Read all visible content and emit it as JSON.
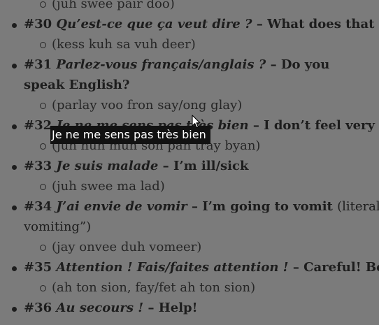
{
  "entries": [
    {
      "num": "",
      "french": "",
      "dash": "",
      "english": "",
      "literal": "",
      "pron": "(juh swee pair doo)"
    },
    {
      "num": "#30",
      "french": "Qu’est-ce que ça veut dire ?",
      "dash": "–",
      "english": "What does that m",
      "literal": "",
      "pron": "(kess kuh sa vuh deer)"
    },
    {
      "num": "#31",
      "french": "Parlez-vous français/anglais ?",
      "dash": "–",
      "english": "Do you speak English?",
      "literal": "",
      "pron": "(parlay voo fron say/ong glay)"
    },
    {
      "num": "#32",
      "french": "Je ne me sens pas très bien",
      "dash": "–",
      "english": "I don’t feel very w",
      "literal": "",
      "pron": "(juh nuh muh son pah tray byan)"
    },
    {
      "num": "#33",
      "french": "Je suis malade",
      "dash": "–",
      "english": "I’m ill/sick",
      "literal": "",
      "pron": "(juh swee ma lad)"
    },
    {
      "num": "#34",
      "french": "J’ai envie de vomir",
      "dash": "–",
      "english": "I’m going to vomit",
      "literal": "(literall vomiting”)",
      "pron": "(jay onvee duh vomeer)"
    },
    {
      "num": "#35",
      "french": "Attention ! Fais/faites attention !",
      "dash": "–",
      "english": "Careful! Be C",
      "literal": "",
      "pron": "(ah ton sion, fay/fet ah ton sion)"
    },
    {
      "num": "#36",
      "french": "Au secours !",
      "dash": "–",
      "english": "Help!",
      "literal": "",
      "pron": ""
    }
  ],
  "tooltip": {
    "text": "Je ne me sens pas très bien"
  },
  "colors": {
    "overlay": "#7b7b7b",
    "text": "#1d1d1d",
    "tooltip_bg": "#121212",
    "tooltip_text": "#ffffff"
  },
  "icons": {
    "cursor": "mouse-pointer-icon"
  }
}
